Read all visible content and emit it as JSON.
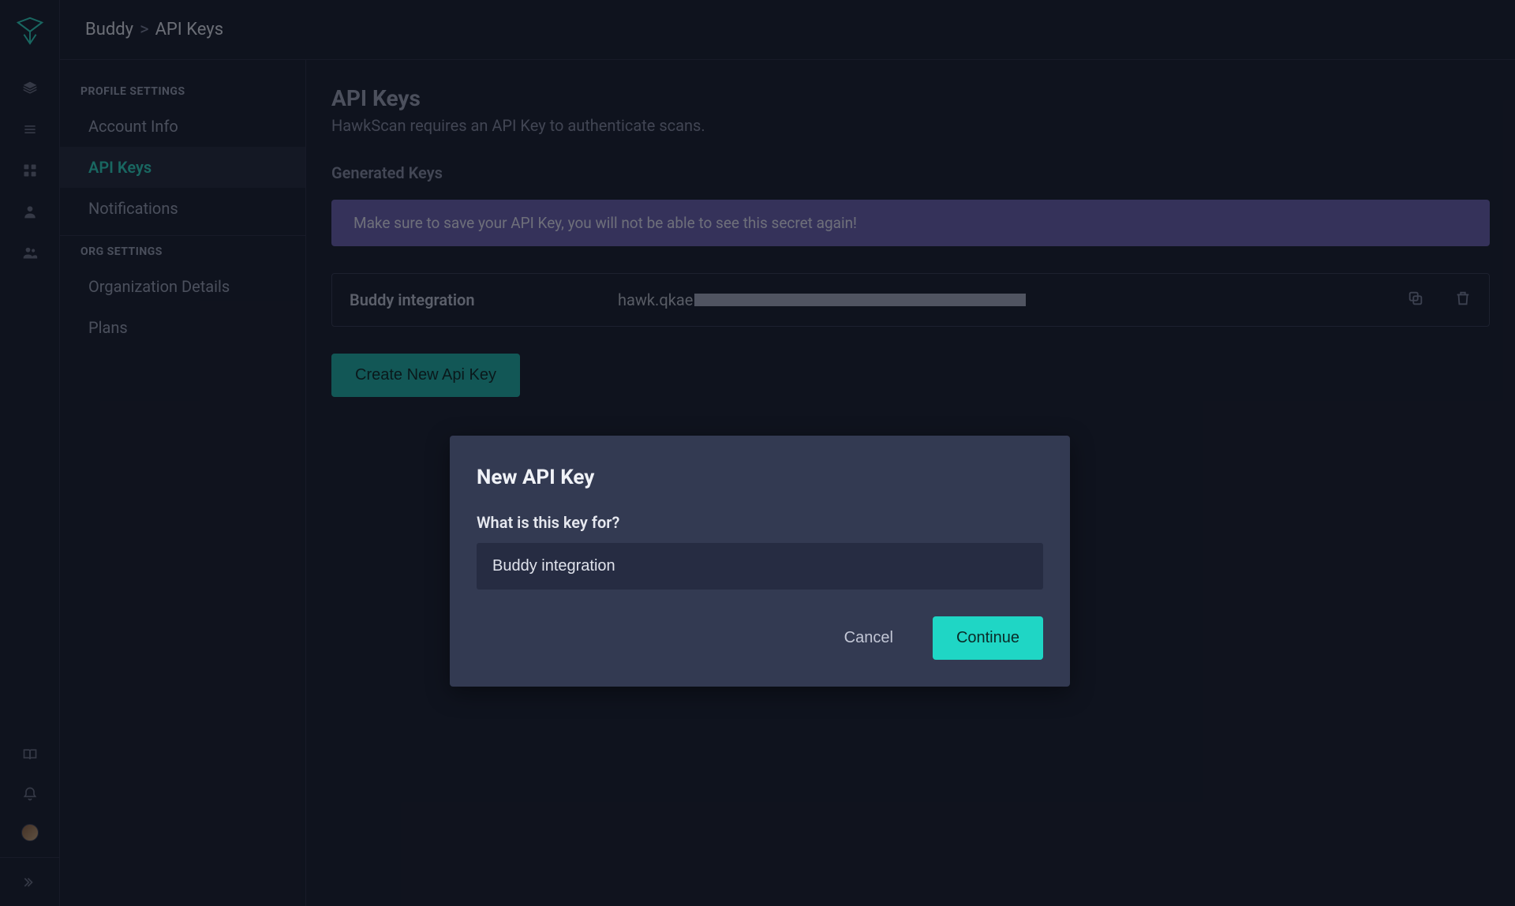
{
  "breadcrumb": {
    "root": "Buddy",
    "sep": ">",
    "current": "API Keys"
  },
  "rail": {
    "icons": [
      "layers-icon",
      "menu-icon",
      "apps-icon",
      "user-icon",
      "team-icon"
    ],
    "bottom_icons": [
      "book-icon",
      "notify-icon"
    ]
  },
  "sidebar": {
    "groups": [
      {
        "label": "PROFILE SETTINGS",
        "items": [
          {
            "label": "Account Info",
            "active": false
          },
          {
            "label": "API Keys",
            "active": true
          },
          {
            "label": "Notifications",
            "active": false
          }
        ]
      },
      {
        "label": "ORG SETTINGS",
        "items": [
          {
            "label": "Organization Details",
            "active": false
          },
          {
            "label": "Plans",
            "active": false
          }
        ]
      }
    ]
  },
  "page": {
    "title": "API Keys",
    "subtitle": "HawkScan requires an API Key to authenticate scans.",
    "section_label": "Generated Keys",
    "banner": "Make sure to save your API Key, you will not be able to see this secret again!",
    "keys": [
      {
        "name": "Buddy integration",
        "value_prefix": "hawk.qkae"
      }
    ],
    "create_button": "Create New Api Key"
  },
  "modal": {
    "title": "New API Key",
    "label": "What is this key for?",
    "input_value": "Buddy integration",
    "cancel": "Cancel",
    "continue": "Continue"
  }
}
